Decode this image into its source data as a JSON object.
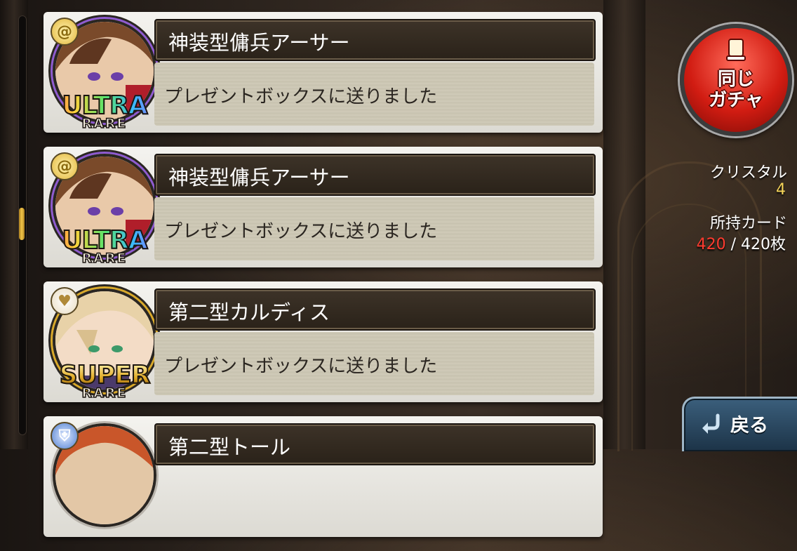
{
  "cards": [
    {
      "name": "神装型傭兵アーサー",
      "message": "プレゼントボックスに送りました",
      "rarity_main": "ULTRA",
      "rarity_sub": "RARE",
      "element_icon": "swirl-icon",
      "rarity_class": "ur"
    },
    {
      "name": "神装型傭兵アーサー",
      "message": "プレゼントボックスに送りました",
      "rarity_main": "ULTRA",
      "rarity_sub": "RARE",
      "element_icon": "swirl-icon",
      "rarity_class": "ur"
    },
    {
      "name": "第二型カルディス",
      "message": "プレゼントボックスに送りました",
      "rarity_main": "SUPER",
      "rarity_sub": "RARE",
      "element_icon": "heart-crown-icon",
      "rarity_class": "sr"
    },
    {
      "name": "第二型トール",
      "message": "",
      "rarity_main": "",
      "rarity_sub": "",
      "element_icon": "shield-icon",
      "rarity_class": ""
    }
  ],
  "gacha_button": {
    "label": "同じ\nガチャ"
  },
  "crystal": {
    "label": "クリスタル",
    "value": "4"
  },
  "owned_cards": {
    "label": "所持カード",
    "current": "420",
    "separator": " / ",
    "max": "420枚"
  },
  "back_button": {
    "label": "戻る"
  },
  "colors": {
    "accent_red": "#ff3b2f",
    "crystal_gold": "#f5d45a"
  }
}
